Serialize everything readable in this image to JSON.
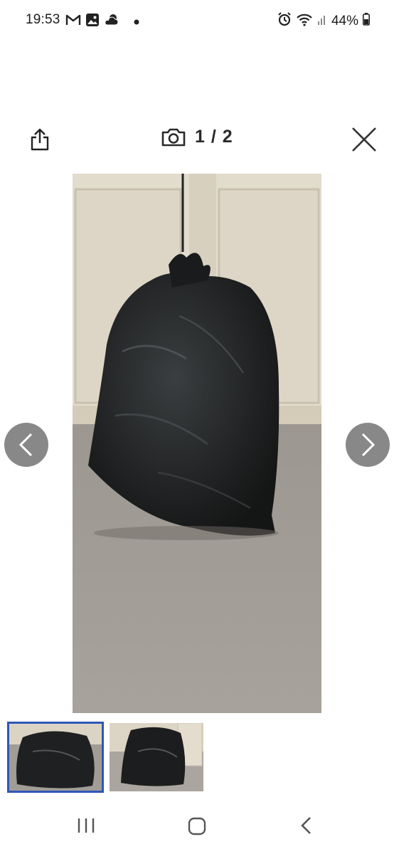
{
  "status_bar": {
    "time": "19:53",
    "left_icons": [
      "gmail-icon",
      "gallery-icon",
      "weather-icon",
      "dot-icon"
    ],
    "right_icons": [
      "alarm-icon",
      "wifi-icon",
      "signal-icon"
    ],
    "battery_percent": "44%"
  },
  "viewer": {
    "counter": "1 / 2",
    "current_index": 1,
    "total": 2
  },
  "photos": [
    {
      "name": "black-bin-bag-photo-1",
      "selected": true
    },
    {
      "name": "black-bin-bag-photo-2",
      "selected": false
    }
  ],
  "colors": {
    "thumb_selected_border": "#2f56b8",
    "nav_arrow_bg": "#787878"
  }
}
